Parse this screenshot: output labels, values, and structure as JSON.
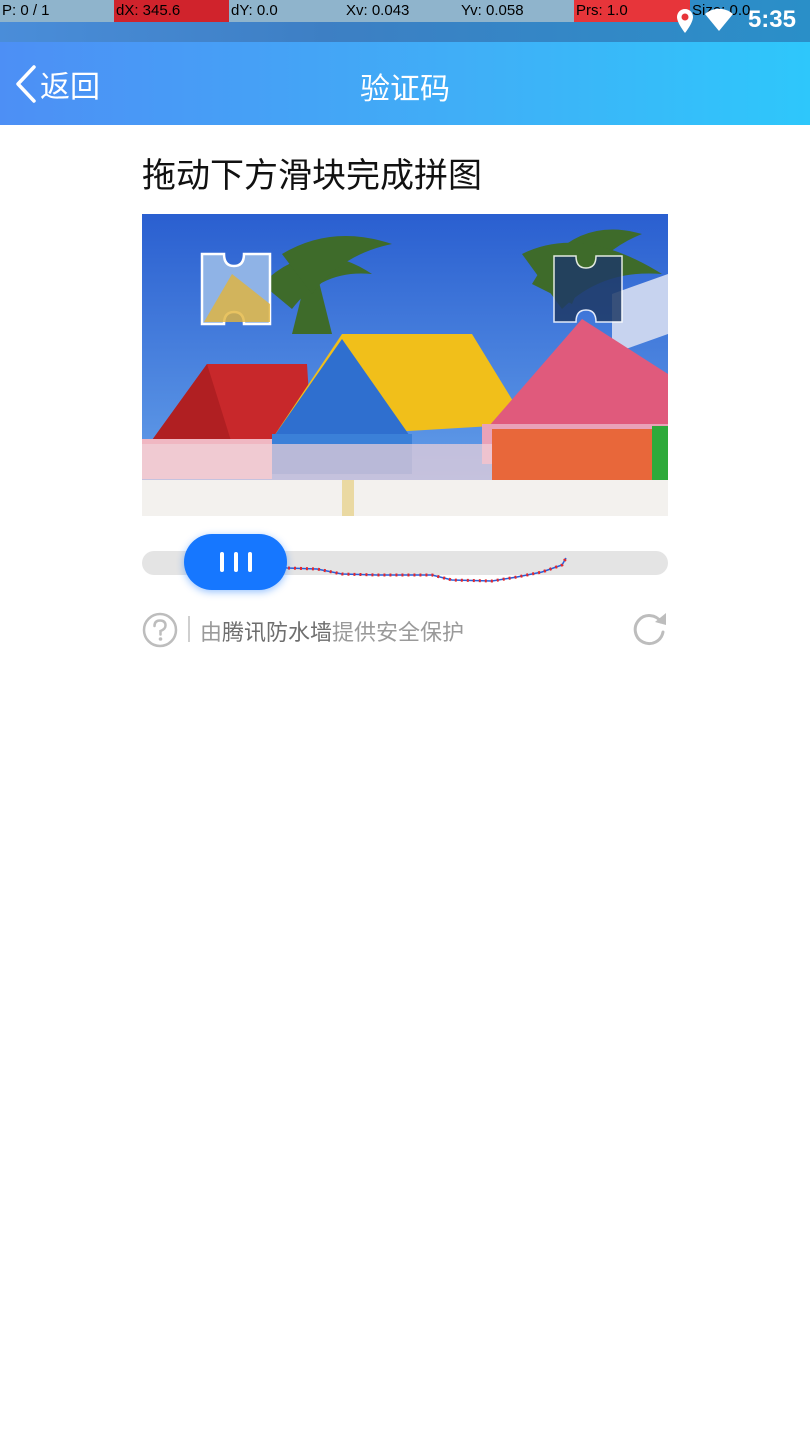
{
  "debug_bar": {
    "pointer": "P: 0 / 1",
    "dx": "dX: 345.6",
    "dy": "dY: 0.0",
    "xv": "Xv: 0.043",
    "yv": "Yv: 0.058",
    "prs": "Prs: 1.0",
    "size": "Size: 0.0"
  },
  "status": {
    "time": "5:35",
    "icons": [
      "location-icon",
      "wifi-icon"
    ]
  },
  "header": {
    "back_label": "返回",
    "title": "验证码"
  },
  "captcha": {
    "instruction": "拖动下方滑块完成拼图",
    "provided_prefix": "由",
    "provided_brand": "腾讯防水墙",
    "provided_suffix": "提供安全保护",
    "icons": [
      "help-icon",
      "refresh-icon",
      "slider-grip-icon"
    ]
  },
  "colors": {
    "header_start": "#4d8ff5",
    "header_end": "#2ec7fb",
    "slider_handle": "#1677ff",
    "track": "#e4e4e4"
  }
}
